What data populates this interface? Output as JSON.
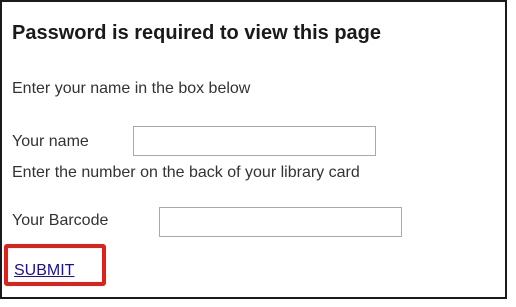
{
  "form": {
    "title": "Password is required to view this page",
    "name_instruction": "Enter your name in the box below",
    "name_label": "Your name",
    "name_value": "",
    "barcode_instruction": "Enter the number on the back of your library card",
    "barcode_label": "Your Barcode",
    "barcode_value": "",
    "submit_label": "SUBMIT"
  },
  "colors": {
    "highlight": "#e0201a",
    "link": "#1a0dab"
  }
}
